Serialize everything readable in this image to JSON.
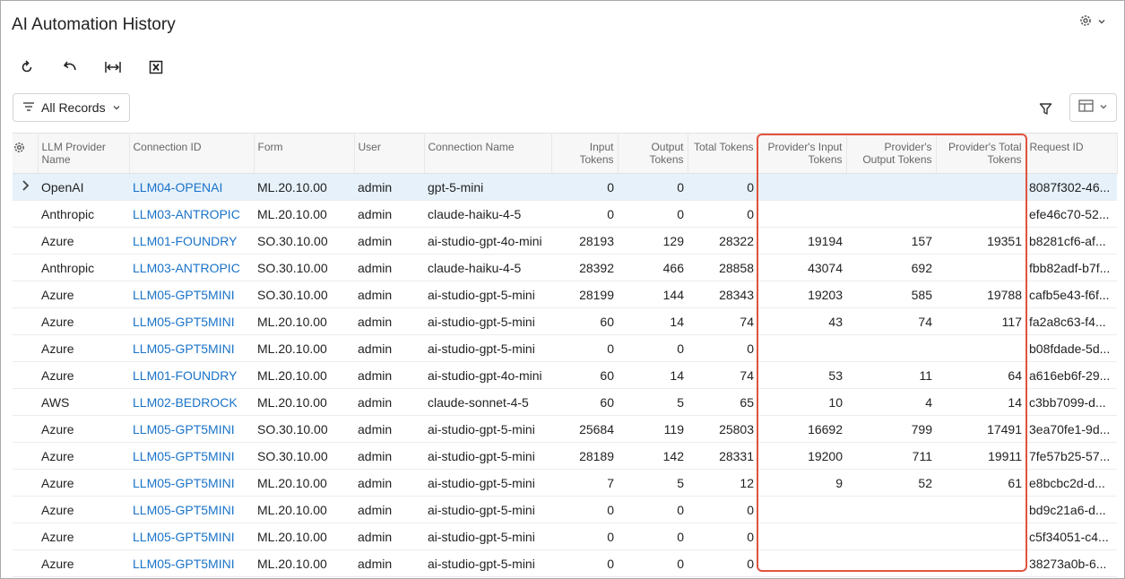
{
  "title": "AI Automation History",
  "toolbar": {
    "refresh_icon": "refresh-icon",
    "undo_icon": "undo-icon",
    "fit_columns_icon": "fit-columns-icon",
    "excel_icon": "excel-icon"
  },
  "filter": {
    "records_label": "All Records"
  },
  "colors": {
    "link": "#1a73c8",
    "highlight": "#e0533d",
    "selected_row": "#e6f1fa"
  },
  "columns": [
    {
      "label": "LLM Provider Name"
    },
    {
      "label": "Connection ID"
    },
    {
      "label": "Form"
    },
    {
      "label": "User"
    },
    {
      "label": "Connection Name"
    },
    {
      "label": "Input Tokens"
    },
    {
      "label": "Output Tokens"
    },
    {
      "label": "Total Tokens"
    },
    {
      "label": "Provider's Input Tokens"
    },
    {
      "label": "Provider's Output Tokens"
    },
    {
      "label": "Provider's Total Tokens"
    },
    {
      "label": "Request ID"
    }
  ],
  "rows": [
    [
      "OpenAI",
      "LLM04-OPENAI",
      "ML.20.10.00",
      "admin",
      "gpt-5-mini",
      "0",
      "0",
      "0",
      "",
      "",
      "",
      "8087f302-46..."
    ],
    [
      "Anthropic",
      "LLM03-ANTROPIC",
      "ML.20.10.00",
      "admin",
      "claude-haiku-4-5",
      "0",
      "0",
      "0",
      "",
      "",
      "",
      "efe46c70-52..."
    ],
    [
      "Azure",
      "LLM01-FOUNDRY",
      "SO.30.10.00",
      "admin",
      "ai-studio-gpt-4o-mini",
      "28193",
      "129",
      "28322",
      "19194",
      "157",
      "19351",
      "b8281cf6-af..."
    ],
    [
      "Anthropic",
      "LLM03-ANTROPIC",
      "SO.30.10.00",
      "admin",
      "claude-haiku-4-5",
      "28392",
      "466",
      "28858",
      "43074",
      "692",
      "",
      "fbb82adf-b7f..."
    ],
    [
      "Azure",
      "LLM05-GPT5MINI",
      "SO.30.10.00",
      "admin",
      "ai-studio-gpt-5-mini",
      "28199",
      "144",
      "28343",
      "19203",
      "585",
      "19788",
      "cafb5e43-f6f..."
    ],
    [
      "Azure",
      "LLM05-GPT5MINI",
      "ML.20.10.00",
      "admin",
      "ai-studio-gpt-5-mini",
      "60",
      "14",
      "74",
      "43",
      "74",
      "117",
      "fa2a8c63-f4..."
    ],
    [
      "Azure",
      "LLM05-GPT5MINI",
      "ML.20.10.00",
      "admin",
      "ai-studio-gpt-5-mini",
      "0",
      "0",
      "0",
      "",
      "",
      "",
      "b08fdade-5d..."
    ],
    [
      "Azure",
      "LLM01-FOUNDRY",
      "ML.20.10.00",
      "admin",
      "ai-studio-gpt-4o-mini",
      "60",
      "14",
      "74",
      "53",
      "11",
      "64",
      "a616eb6f-29..."
    ],
    [
      "AWS",
      "LLM02-BEDROCK",
      "ML.20.10.00",
      "admin",
      "claude-sonnet-4-5",
      "60",
      "5",
      "65",
      "10",
      "4",
      "14",
      "c3bb7099-d..."
    ],
    [
      "Azure",
      "LLM05-GPT5MINI",
      "SO.30.10.00",
      "admin",
      "ai-studio-gpt-5-mini",
      "25684",
      "119",
      "25803",
      "16692",
      "799",
      "17491",
      "3ea70fe1-9d..."
    ],
    [
      "Azure",
      "LLM05-GPT5MINI",
      "SO.30.10.00",
      "admin",
      "ai-studio-gpt-5-mini",
      "28189",
      "142",
      "28331",
      "19200",
      "711",
      "19911",
      "7fe57b25-57..."
    ],
    [
      "Azure",
      "LLM05-GPT5MINI",
      "ML.20.10.00",
      "admin",
      "ai-studio-gpt-5-mini",
      "7",
      "5",
      "12",
      "9",
      "52",
      "61",
      "e8bcbc2d-d..."
    ],
    [
      "Azure",
      "LLM05-GPT5MINI",
      "ML.20.10.00",
      "admin",
      "ai-studio-gpt-5-mini",
      "0",
      "0",
      "0",
      "",
      "",
      "",
      "bd9c21a6-d..."
    ],
    [
      "Azure",
      "LLM05-GPT5MINI",
      "ML.20.10.00",
      "admin",
      "ai-studio-gpt-5-mini",
      "0",
      "0",
      "0",
      "",
      "",
      "",
      "c5f34051-c4..."
    ],
    [
      "Azure",
      "LLM05-GPT5MINI",
      "ML.20.10.00",
      "admin",
      "ai-studio-gpt-5-mini",
      "0",
      "0",
      "0",
      "",
      "",
      "",
      "38273a0b-6..."
    ]
  ]
}
